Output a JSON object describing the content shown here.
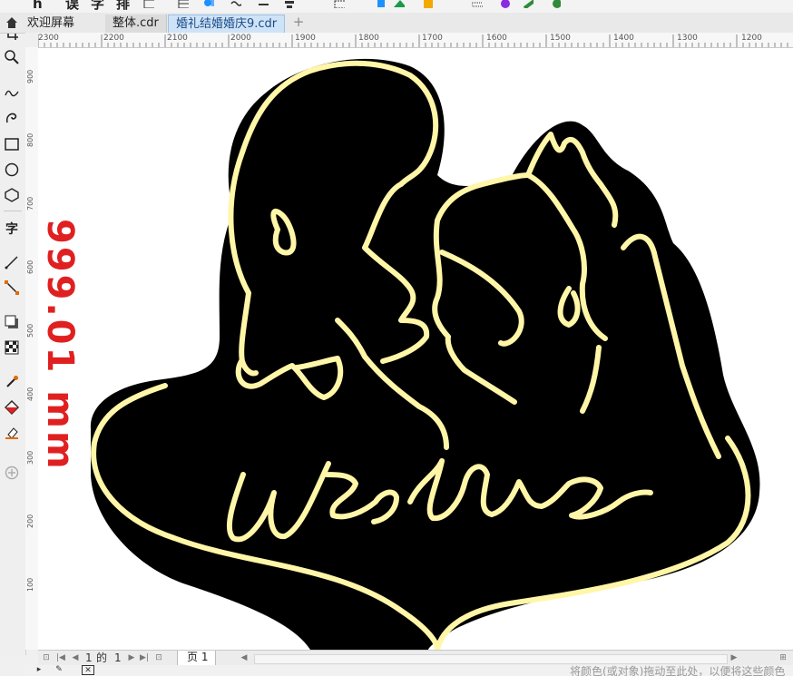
{
  "toolbar": {
    "glyphs": [
      "h",
      "误",
      "字",
      "排"
    ],
    "icon_colors": [
      "#1e90ff",
      "#1a9a4a",
      "#f2a900",
      "#8a2be2",
      "#2e8b3a"
    ]
  },
  "tabs": {
    "home_icon": "home-icon",
    "items": [
      {
        "label": "欢迎屏幕"
      },
      {
        "label": "整体.cdr"
      },
      {
        "label": "婚礼结婚婚庆9.cdr"
      }
    ],
    "add_label": "+"
  },
  "ruler_top": [
    "2300",
    "2200",
    "2100",
    "2000",
    "1900",
    "1800",
    "1700",
    "1600",
    "1500",
    "1400",
    "1300",
    "1200"
  ],
  "ruler_left": [
    "900",
    "800",
    "700",
    "600",
    "500",
    "400",
    "300",
    "200",
    "100"
  ],
  "canvas": {
    "side_text": "999.01 mm",
    "artwork_word": "Wedding",
    "colors": {
      "outline": "#fff6a8",
      "fill": "#000000",
      "dimension": "#e02020"
    }
  },
  "pagenav": {
    "current": "1",
    "of_label": "的",
    "total": "1",
    "page_tab": "页 1"
  },
  "status": {
    "hint": "将颜色(或对象)拖动至此处，以便将这些颜色"
  }
}
